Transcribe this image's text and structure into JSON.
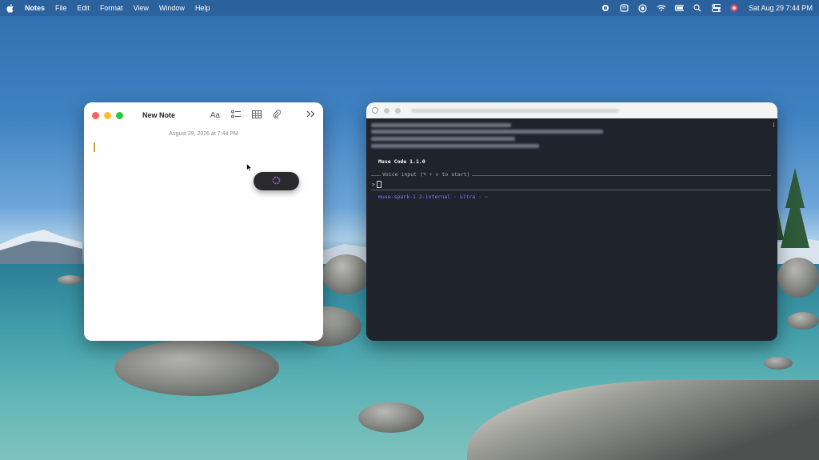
{
  "menubar": {
    "app_name": "Notes",
    "menus": [
      "File",
      "Edit",
      "Format",
      "View",
      "Window",
      "Help"
    ],
    "clock": "Sat Aug 29  7:44 PM"
  },
  "notes_window": {
    "title": "New Note",
    "date": "August 29, 2026 at 7:44 PM",
    "format_label": "Aa",
    "accent_color": "#c9a63c"
  },
  "dictation_pill": {
    "icon": "recording-indicator-icon",
    "color": "#9b5cff"
  },
  "terminal": {
    "header": "Muse Code 1.1.0",
    "voice_label": "Voice input (⌥ + v to start)",
    "prompt": ">",
    "status": "muse-spark-1.2-internal · ultra · ~"
  }
}
